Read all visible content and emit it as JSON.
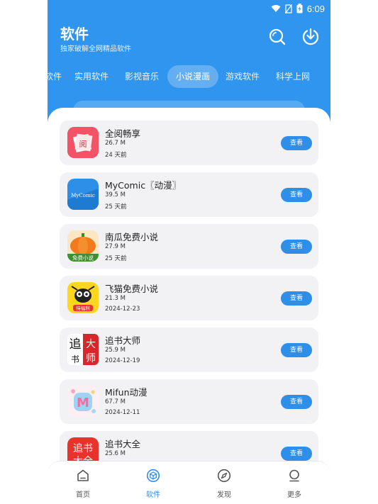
{
  "status_bar": {
    "time": "6:09",
    "icons": [
      "wifi-icon",
      "no-sim-icon",
      "battery-icon"
    ]
  },
  "header": {
    "title": "软件",
    "subtitle": "独家破解全网精品软件",
    "search_icon": "search-icon",
    "download_icon": "download-icon",
    "bg_color": "#2f95ee"
  },
  "tabs": [
    {
      "label": "软件"
    },
    {
      "label": "实用软件"
    },
    {
      "label": "影视音乐"
    },
    {
      "label": "小说漫画",
      "active": true
    },
    {
      "label": "游戏软件"
    },
    {
      "label": "科学上网"
    }
  ],
  "apps": [
    {
      "name": "全阅畅享",
      "size": "26.7 M",
      "date": "24 天前",
      "button": "查看",
      "icon": "quanyue-app-icon",
      "icon_text": "阅"
    },
    {
      "name": "MyComic〖动漫〗",
      "size": "39.5 M",
      "date": "25 天前",
      "button": "查看",
      "icon": "mycomic-app-icon",
      "icon_text": "MyComic"
    },
    {
      "name": "南瓜免费小说",
      "size": "27.9 M",
      "date": "25 天前",
      "button": "查看",
      "icon": "pumpkin-app-icon",
      "icon_text": "免费小说"
    },
    {
      "name": "飞猫免费小说",
      "size": "21.3 M",
      "date": "2024-12-23",
      "button": "查看",
      "icon": "feimao-app-icon",
      "icon_text": "恃福利"
    },
    {
      "name": "追书大师",
      "size": "25.9 M",
      "date": "2024-12-19",
      "button": "查看",
      "icon": "zhuishu-master-app-icon",
      "icon_text_1": "追",
      "icon_text_2": "大",
      "icon_text_3": "书",
      "icon_text_4": "师"
    },
    {
      "name": "Mifun动漫",
      "size": "67.7 M",
      "date": "2024-12-11",
      "button": "查看",
      "icon": "mifun-app-icon",
      "icon_text": "M"
    },
    {
      "name": "追书大全",
      "size": "25.6 M",
      "date": "",
      "button": "查看",
      "icon": "zhuishu-daquan-app-icon",
      "icon_text_1": "追书",
      "icon_text_2": "大全"
    }
  ],
  "bottom_nav": [
    {
      "label": "首页",
      "icon": "home-icon"
    },
    {
      "label": "软件",
      "icon": "cube-icon",
      "active": true
    },
    {
      "label": "发现",
      "icon": "compass-icon"
    },
    {
      "label": "更多",
      "icon": "user-icon"
    }
  ],
  "colors": {
    "accent": "#2f8ee8",
    "card_bg": "#f2f2f4"
  }
}
